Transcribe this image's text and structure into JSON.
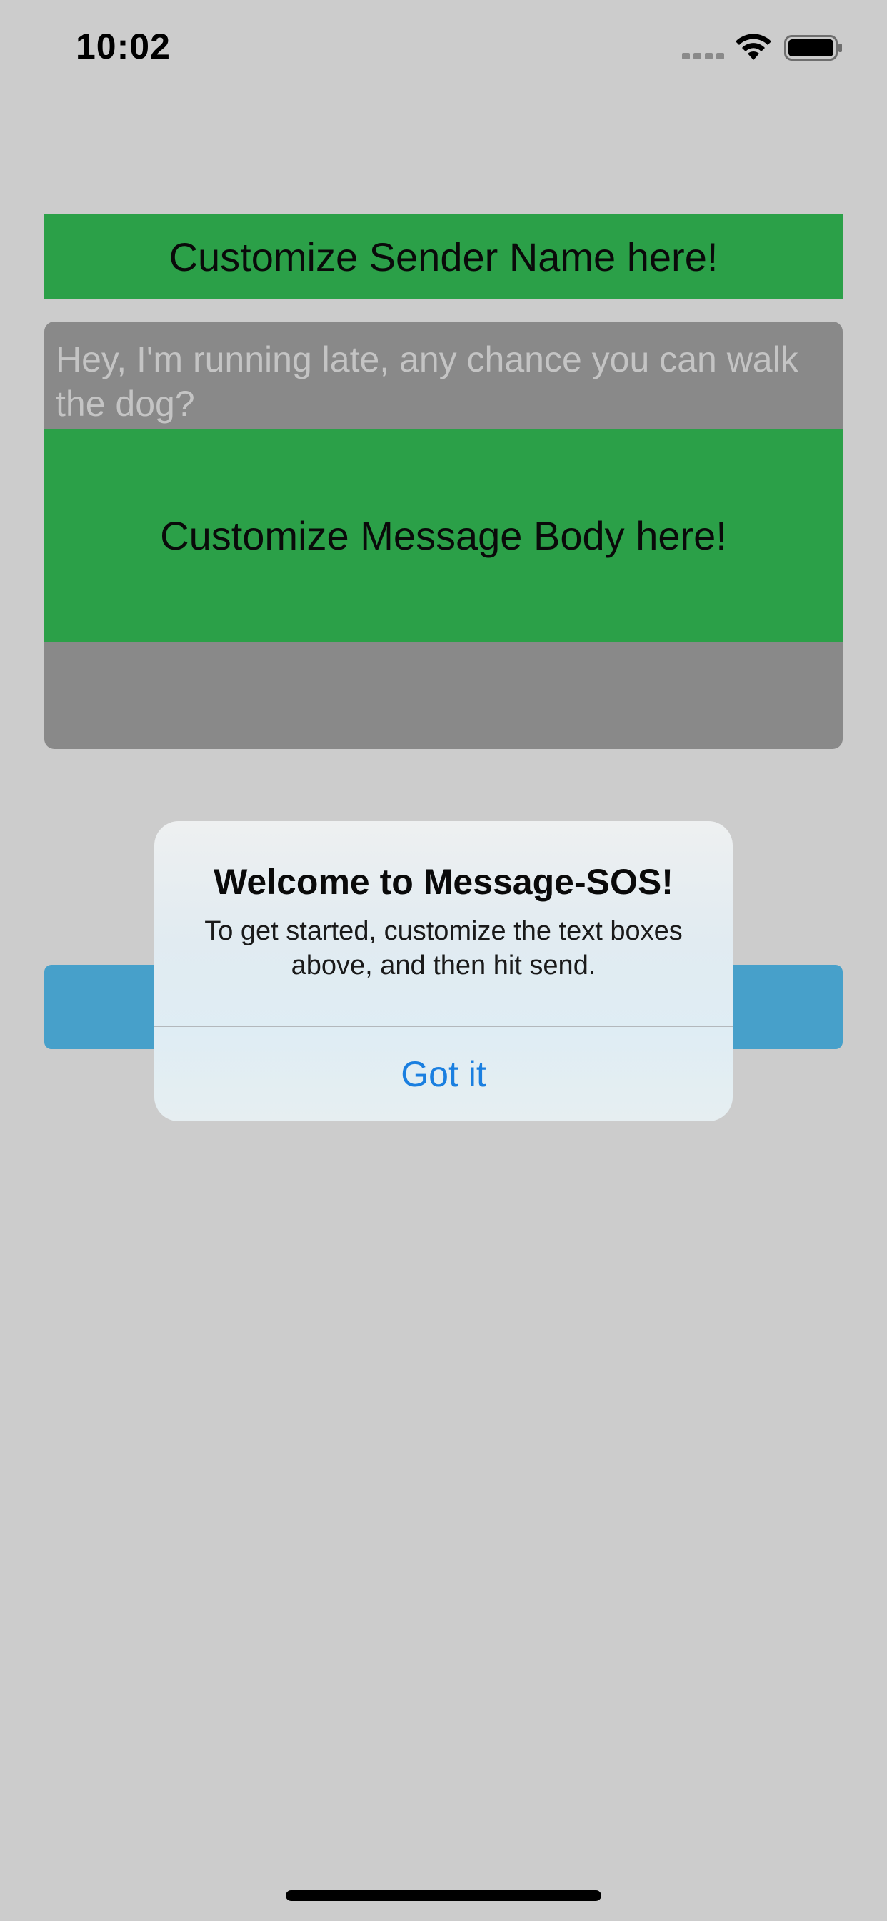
{
  "status_bar": {
    "time": "10:02",
    "icons": [
      "cellular-signal-icon",
      "wifi-icon",
      "battery-icon"
    ]
  },
  "sender": {
    "label": "Customize Sender Name here!"
  },
  "message": {
    "placeholder": "Hey, I'm running late, any chance you can walk the dog?",
    "customize_label": "Customize Message Body here!"
  },
  "alert": {
    "title": "Welcome to Message-SOS!",
    "message": "To get started, customize the text boxes above, and then hit send.",
    "button_label": "Got it"
  },
  "colors": {
    "background": "#cccccc",
    "accent_green": "#2ba048",
    "text_view_gray": "#898989",
    "send_blue": "#47a0ca",
    "alert_button_blue": "#1a7fe0"
  }
}
